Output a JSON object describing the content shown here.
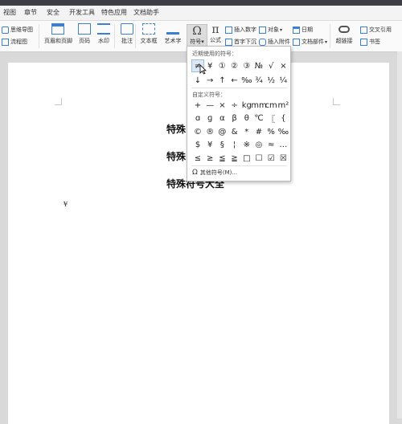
{
  "tabs": [
    "视图",
    "章节",
    "安全",
    "开发工具",
    "特色应用",
    "文档助手"
  ],
  "ribbon": {
    "mindmap": "思维导图",
    "flowchart": "流程图",
    "header_footer": "页眉和页脚",
    "page_number": "页码",
    "watermark": "水印",
    "comment": "批注",
    "textbox": "文本框",
    "wordart": "艺术字",
    "symbol": "符号",
    "formula": "公式",
    "insert_number": "插入数字",
    "object": "对象",
    "date": "日期",
    "first_drop": "首字下沉",
    "insert_attachment": "插入附件",
    "doc_parts": "文档部件",
    "hyperlink": "超链接",
    "cross_ref": "交叉引用",
    "bookmark": "书签"
  },
  "symbol_panel": {
    "recent_title": "近期使用的符号：",
    "recent_row1": [
      "≠",
      "¥",
      "①",
      "②",
      "③",
      "№",
      "√",
      "×"
    ],
    "recent_row2": [
      "↓",
      "→",
      "↑",
      "←",
      "‰",
      "¾",
      "½",
      "¼"
    ],
    "custom_title": "自定义符号：",
    "custom_rows": [
      [
        "+",
        "—",
        "×",
        "÷",
        "kg",
        "mm",
        "cm",
        "m²"
      ],
      [
        "ɑ",
        "ɡ",
        "α",
        "β",
        "θ",
        "℃",
        "〖",
        "{"
      ],
      [
        "©",
        "®",
        "@",
        "&",
        "*",
        "#",
        "%",
        "‰"
      ],
      [
        "$",
        "¥",
        "§",
        "¦",
        "※",
        "◎",
        "≈",
        "…"
      ],
      [
        "≤",
        "≥",
        "≦",
        "≧",
        "□",
        "☐",
        "☑",
        "☒"
      ]
    ],
    "more": "其他符号(M)..."
  },
  "document": {
    "line1": "特殊",
    "line2": "特殊",
    "line3": "特殊符号大全",
    "yen": "¥"
  }
}
